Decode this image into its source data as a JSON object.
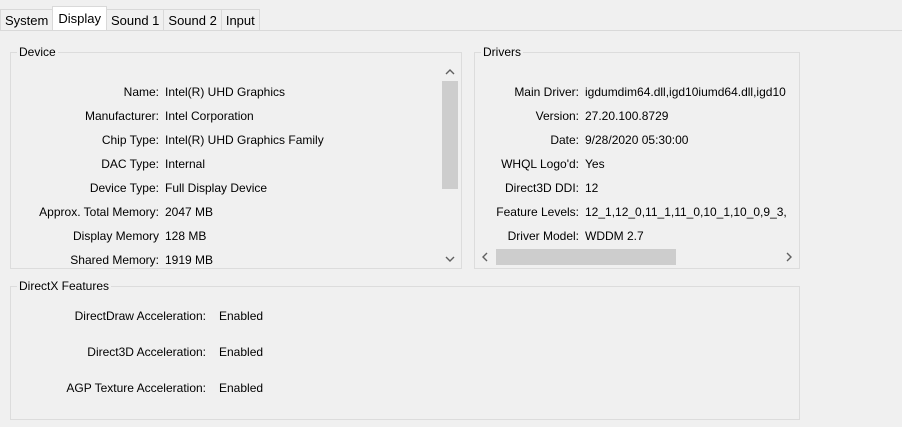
{
  "tabs": [
    {
      "label": "System"
    },
    {
      "label": "Display"
    },
    {
      "label": "Sound 1"
    },
    {
      "label": "Sound 2"
    },
    {
      "label": "Input"
    }
  ],
  "device": {
    "title": "Device",
    "rows": [
      {
        "label": "Name:",
        "value": "Intel(R) UHD Graphics"
      },
      {
        "label": "Manufacturer:",
        "value": "Intel Corporation"
      },
      {
        "label": "Chip Type:",
        "value": "Intel(R) UHD Graphics Family"
      },
      {
        "label": "DAC Type:",
        "value": "Internal"
      },
      {
        "label": "Device Type:",
        "value": "Full Display Device"
      },
      {
        "label": "Approx. Total Memory:",
        "value": "2047 MB"
      },
      {
        "label": "Display Memory",
        "value": "128 MB"
      },
      {
        "label": "Shared Memory:",
        "value": "1919 MB"
      }
    ]
  },
  "drivers": {
    "title": "Drivers",
    "rows": [
      {
        "label": "Main Driver:",
        "value": "igdumdim64.dll,igd10iumd64.dll,igd10"
      },
      {
        "label": "Version:",
        "value": "27.20.100.8729"
      },
      {
        "label": "Date:",
        "value": "9/28/2020 05:30:00"
      },
      {
        "label": "WHQL Logo'd:",
        "value": "Yes"
      },
      {
        "label": "Direct3D DDI:",
        "value": "12"
      },
      {
        "label": "Feature Levels:",
        "value": "12_1,12_0,11_1,11_0,10_1,10_0,9_3,"
      },
      {
        "label": "Driver Model:",
        "value": "WDDM 2.7"
      }
    ]
  },
  "directx": {
    "title": "DirectX Features",
    "rows": [
      {
        "label": "DirectDraw Acceleration:",
        "value": "Enabled"
      },
      {
        "label": "Direct3D Acceleration:",
        "value": "Enabled"
      },
      {
        "label": "AGP Texture Acceleration:",
        "value": "Enabled"
      }
    ]
  },
  "icons": {
    "up": "scroll-up-arrow-icon",
    "down": "scroll-down-arrow-icon",
    "left": "scroll-left-arrow-icon",
    "right": "scroll-right-arrow-icon"
  },
  "colors": {
    "window_bg": "#f0f0f0",
    "active_tab_bg": "#ffffff",
    "group_border": "#dcdcdc",
    "scroll_thumb": "#cdcdcd"
  }
}
